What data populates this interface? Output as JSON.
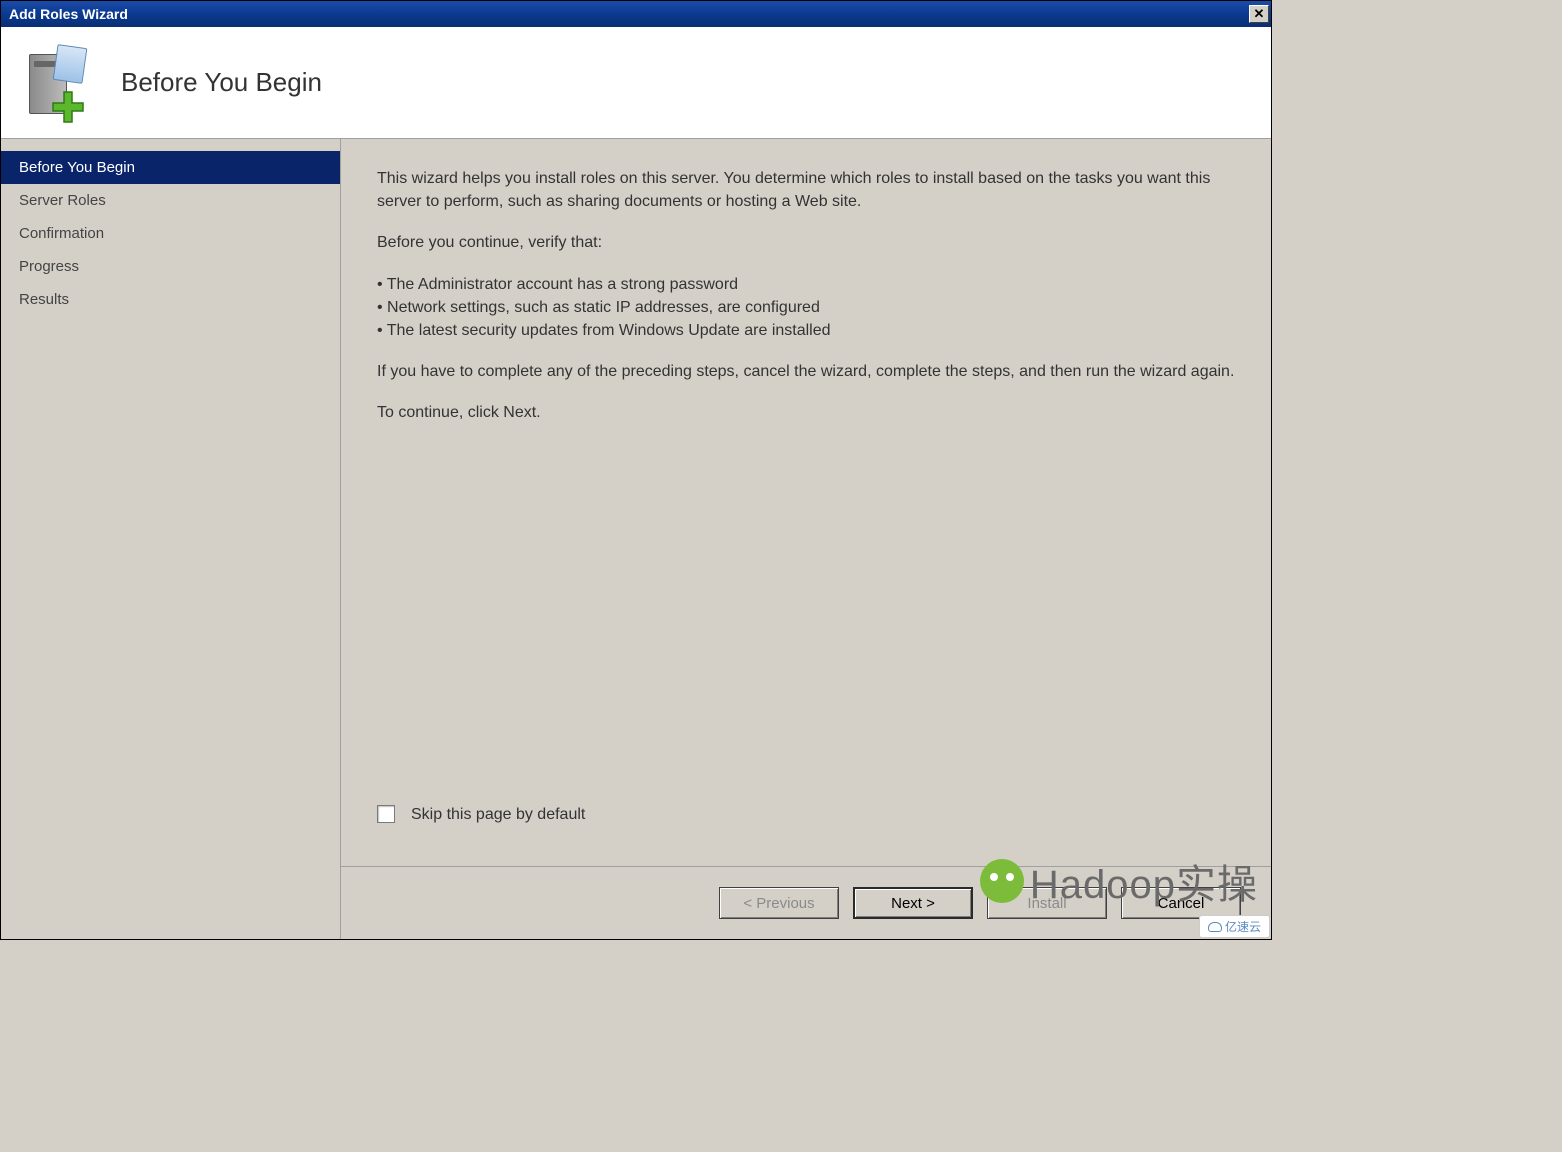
{
  "window": {
    "title": "Add Roles Wizard"
  },
  "header": {
    "page_title": "Before You Begin"
  },
  "sidebar": {
    "items": [
      {
        "label": "Before You Begin",
        "selected": true
      },
      {
        "label": "Server Roles",
        "selected": false
      },
      {
        "label": "Confirmation",
        "selected": false
      },
      {
        "label": "Progress",
        "selected": false
      },
      {
        "label": "Results",
        "selected": false
      }
    ]
  },
  "content": {
    "intro": "This wizard helps you install roles on this server. You determine which roles to install based on the tasks you want this server to perform, such as sharing documents or hosting a Web site.",
    "verify_heading": "Before you continue, verify that:",
    "bullets": [
      "• The Administrator account has a strong password",
      "• Network settings, such as static IP addresses, are configured",
      "• The latest security updates from Windows Update are installed"
    ],
    "cancel_note": "If you have to complete any of the preceding steps, cancel the wizard, complete the steps, and then run the wizard again.",
    "continue_note": "To continue, click Next.",
    "skip_checkbox_label": "Skip this page by default"
  },
  "footer": {
    "previous": "< Previous",
    "next": "Next >",
    "install": "Install",
    "cancel": "Cancel"
  },
  "watermark": {
    "text": "Hadoop实操"
  },
  "corner": {
    "text": "亿速云"
  }
}
